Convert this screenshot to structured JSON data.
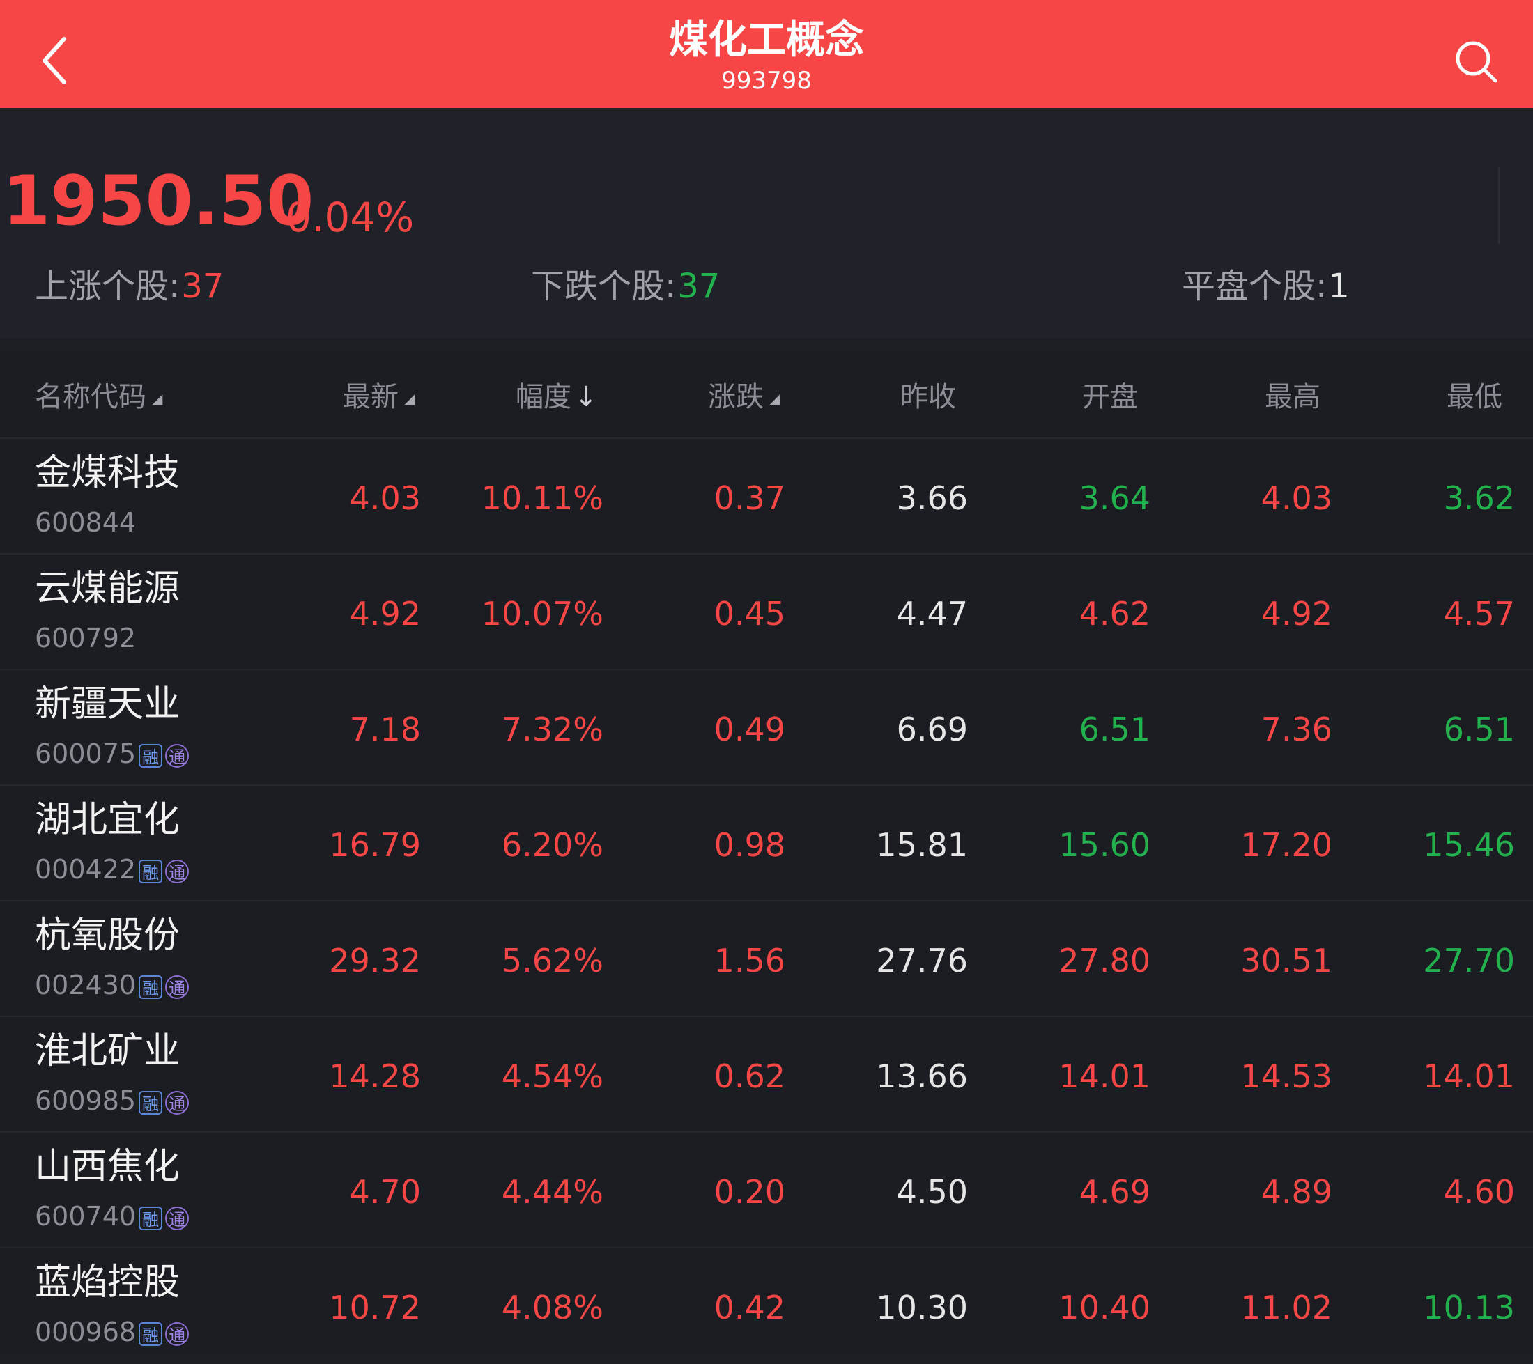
{
  "header": {
    "title": "煤化工概念",
    "code": "993798",
    "back_icon": "chevron-left-icon",
    "search_icon": "search-icon"
  },
  "summary": {
    "price": "1950.50",
    "change_pct": "0.04%",
    "up_label": "上涨个股:",
    "up_value": "37",
    "down_label": "下跌个股:",
    "down_value": "37",
    "flat_label": "平盘个股:",
    "flat_value": "1"
  },
  "table": {
    "columns": {
      "name_code": "名称代码",
      "latest": "最新",
      "amplitude": "幅度",
      "change": "涨跌",
      "prev_close": "昨收",
      "open": "开盘",
      "high": "最高",
      "low": "最低"
    },
    "tags": {
      "margin": "融",
      "connect": "通"
    },
    "rows": [
      {
        "name": "金煤科技",
        "code": "600844",
        "latest": "4.03",
        "amplitude": "10.11%",
        "change": "0.37",
        "prev_close": "3.66",
        "open": "3.64",
        "high": "4.03",
        "low": "3.62"
      },
      {
        "name": "云煤能源",
        "code": "600792",
        "latest": "4.92",
        "amplitude": "10.07%",
        "change": "0.45",
        "prev_close": "4.47",
        "open": "4.62",
        "high": "4.92",
        "low": "4.57"
      },
      {
        "name": "新疆天业",
        "code": "600075",
        "latest": "7.18",
        "amplitude": "7.32%",
        "change": "0.49",
        "prev_close": "6.69",
        "open": "6.51",
        "high": "7.36",
        "low": "6.51"
      },
      {
        "name": "湖北宜化",
        "code": "000422",
        "latest": "16.79",
        "amplitude": "6.20%",
        "change": "0.98",
        "prev_close": "15.81",
        "open": "15.60",
        "high": "17.20",
        "low": "15.46"
      },
      {
        "name": "杭氧股份",
        "code": "002430",
        "latest": "29.32",
        "amplitude": "5.62%",
        "change": "1.56",
        "prev_close": "27.76",
        "open": "27.80",
        "high": "30.51",
        "low": "27.70"
      },
      {
        "name": "淮北矿业",
        "code": "600985",
        "latest": "14.28",
        "amplitude": "4.54%",
        "change": "0.62",
        "prev_close": "13.66",
        "open": "14.01",
        "high": "14.53",
        "low": "14.01"
      },
      {
        "name": "山西焦化",
        "code": "600740",
        "latest": "4.70",
        "amplitude": "4.44%",
        "change": "0.20",
        "prev_close": "4.50",
        "open": "4.69",
        "high": "4.89",
        "low": "4.60"
      },
      {
        "name": "蓝焰控股",
        "code": "000968",
        "latest": "10.72",
        "amplitude": "4.08%",
        "change": "0.42",
        "prev_close": "10.30",
        "open": "10.40",
        "high": "11.02",
        "low": "10.13"
      }
    ]
  },
  "colors": {
    "header_bg": "#f64645",
    "up": "#f64645",
    "down": "#22b14c",
    "background": "#1c1e24"
  }
}
